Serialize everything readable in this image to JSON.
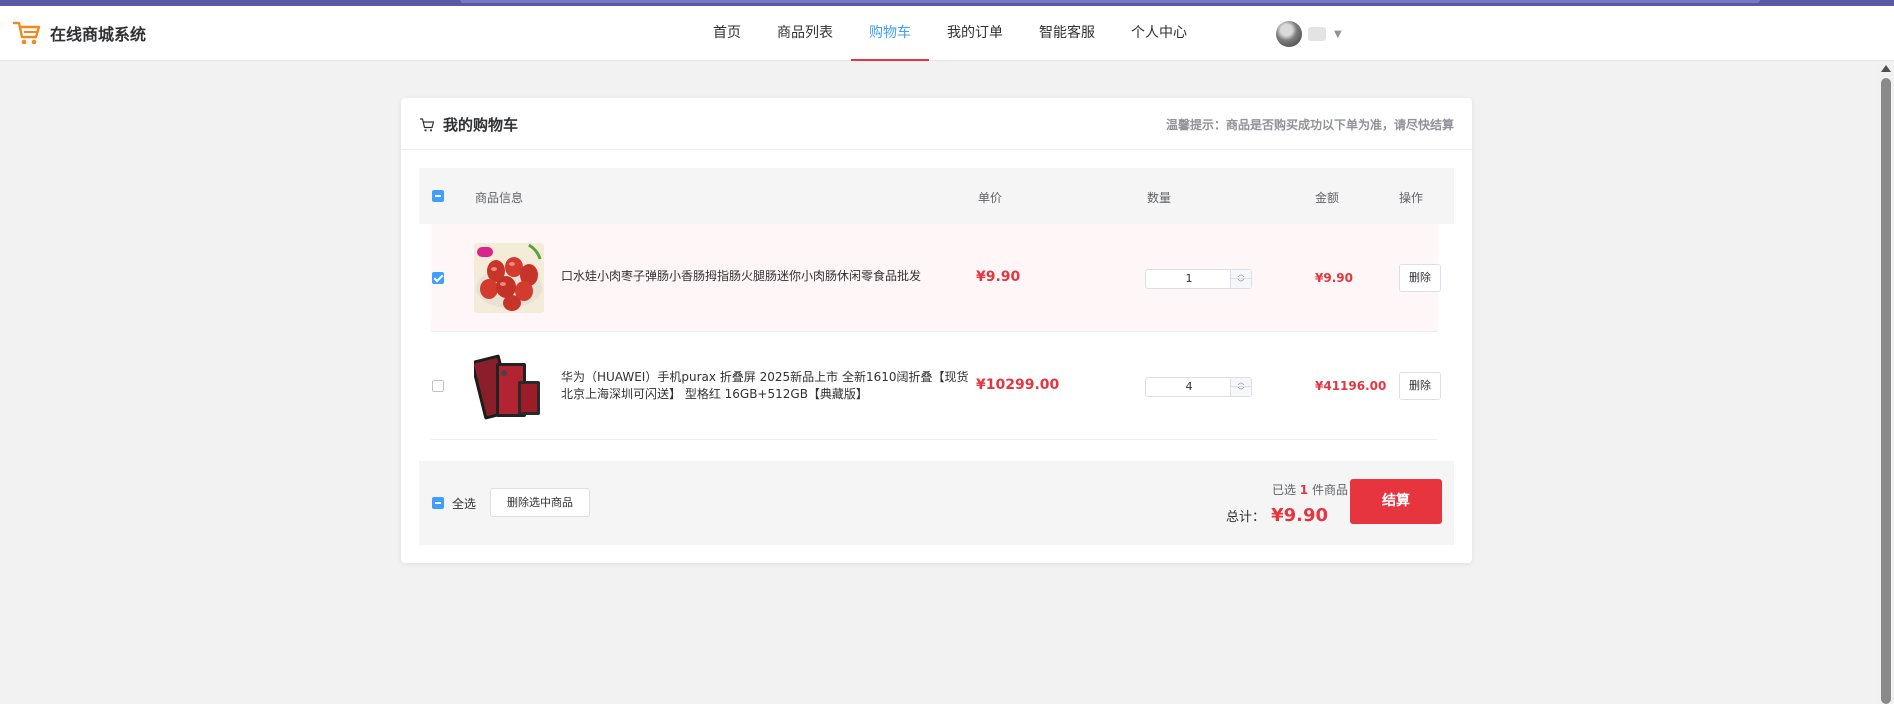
{
  "app": {
    "title": "在线商城系统"
  },
  "nav": {
    "items": [
      {
        "label": "首页",
        "active": false
      },
      {
        "label": "商品列表",
        "active": false
      },
      {
        "label": "购物车",
        "active": true
      },
      {
        "label": "我的订单",
        "active": false
      },
      {
        "label": "智能客服",
        "active": false
      },
      {
        "label": "个人中心",
        "active": false
      }
    ]
  },
  "cart": {
    "title": "我的购物车",
    "tip": "温馨提示：商品是否购买成功以下单为准，请尽快结算",
    "columns": {
      "info": "商品信息",
      "price": "单价",
      "qty": "数量",
      "amount": "金额",
      "action": "操作"
    },
    "items": [
      {
        "name": "口水娃小肉枣子弹肠小香肠拇指肠火腿肠迷你小肉肠休闲零食品批发",
        "price": "¥9.90",
        "quantity": "1",
        "amount": "¥9.90",
        "delete_label": "删除",
        "selected": true
      },
      {
        "name": "华为（HUAWEI）手机purax 折叠屏 2025新品上市 全新1610阔折叠【现货北京上海深圳可闪送】 型格红 16GB+512GB【典藏版】",
        "price": "¥10299.00",
        "quantity": "4",
        "amount": "¥41196.00",
        "delete_label": "删除",
        "selected": false
      }
    ],
    "footer": {
      "select_all_label": "全选",
      "delete_selected_label": "删除选中商品",
      "selected_prefix": "已选",
      "selected_count": "1",
      "selected_suffix": "件商品",
      "total_label": "总计：",
      "total_value": "¥9.90",
      "checkout_label": "结算"
    }
  },
  "colors": {
    "accent": "#409eff",
    "price": "#e6353f",
    "checkout": "#e6353f",
    "header_strip": "#5b58a6"
  },
  "icons": {
    "logo": "shopping-cart-icon",
    "cart_title": "cart-icon",
    "caret": "caret-down-icon"
  }
}
